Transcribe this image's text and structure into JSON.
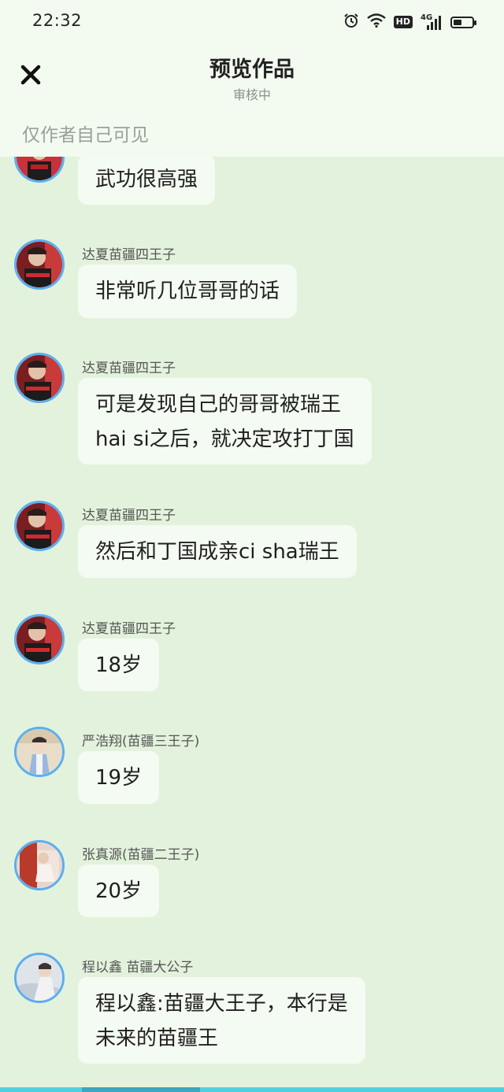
{
  "status_bar": {
    "time": "22:32",
    "hd_label": "HD",
    "network": "4G"
  },
  "header": {
    "title": "预览作品",
    "subtitle": "审核中"
  },
  "notice": "仅作者自己可见",
  "messages": [
    {
      "sender": "",
      "text": [
        "武功很高强"
      ]
    },
    {
      "sender": "达夏苗疆四王子",
      "text": [
        "非常听几位哥哥的话"
      ]
    },
    {
      "sender": "达夏苗疆四王子",
      "text": [
        "可是发现自己的哥哥被瑞王",
        "hai si之后，就决定攻打丁国"
      ]
    },
    {
      "sender": "达夏苗疆四王子",
      "text": [
        "然后和丁国成亲ci sha瑞王"
      ]
    },
    {
      "sender": "达夏苗疆四王子",
      "text": [
        "18岁"
      ]
    },
    {
      "sender": "严浩翔(苗疆三王子)",
      "text": [
        "19岁"
      ]
    },
    {
      "sender": "张真源(苗疆二王子)",
      "text": [
        "20岁"
      ]
    },
    {
      "sender": "程以鑫 苗疆大公子",
      "text": [
        "程以鑫:苗疆大王子，本行是",
        "未来的苗疆王"
      ]
    }
  ],
  "colors": {
    "background": "#e3f2dc",
    "header": "#f3fbf0",
    "bubble": "#f4fbf2",
    "avatar_ring": "#5aaef0"
  },
  "icons": [
    "alarm-icon",
    "wifi-icon",
    "hd-icon",
    "signal-icon",
    "battery-icon",
    "close-icon"
  ]
}
